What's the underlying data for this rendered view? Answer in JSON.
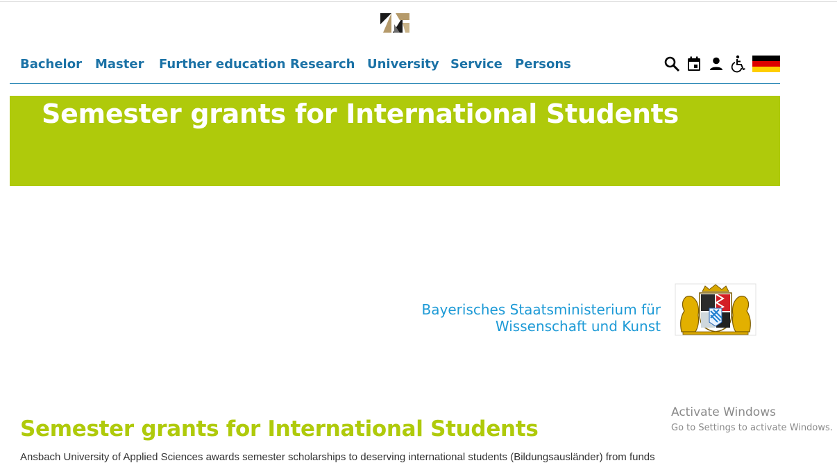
{
  "nav": {
    "items": [
      {
        "label": "Bachelor"
      },
      {
        "label": "Master"
      },
      {
        "label": "Further education"
      },
      {
        "label": "Research"
      },
      {
        "label": "University"
      },
      {
        "label": "Service"
      },
      {
        "label": "Persons"
      }
    ],
    "tools": [
      "search-icon",
      "calendar-icon",
      "person-icon",
      "accessibility-icon",
      "german-flag-icon"
    ]
  },
  "hero": {
    "title": "Semester grants for International Students"
  },
  "ministry": {
    "line1": "Bayerisches Staatsministerium für",
    "line2": "Wissenschaft und Kunst"
  },
  "main": {
    "title": "Semester grants for International Students",
    "intro": "Ansbach University of Applied Sciences awards semester scholarships to deserving international students (Bildungsausländer) from funds"
  },
  "watermark": {
    "title": "Activate Windows",
    "subtitle": "Go to Settings to activate Windows."
  },
  "colors": {
    "nav_text": "#1b72a6",
    "hero_bg": "#afca0b",
    "section_title": "#afca0b",
    "ministry_text": "#1d9ad6"
  }
}
